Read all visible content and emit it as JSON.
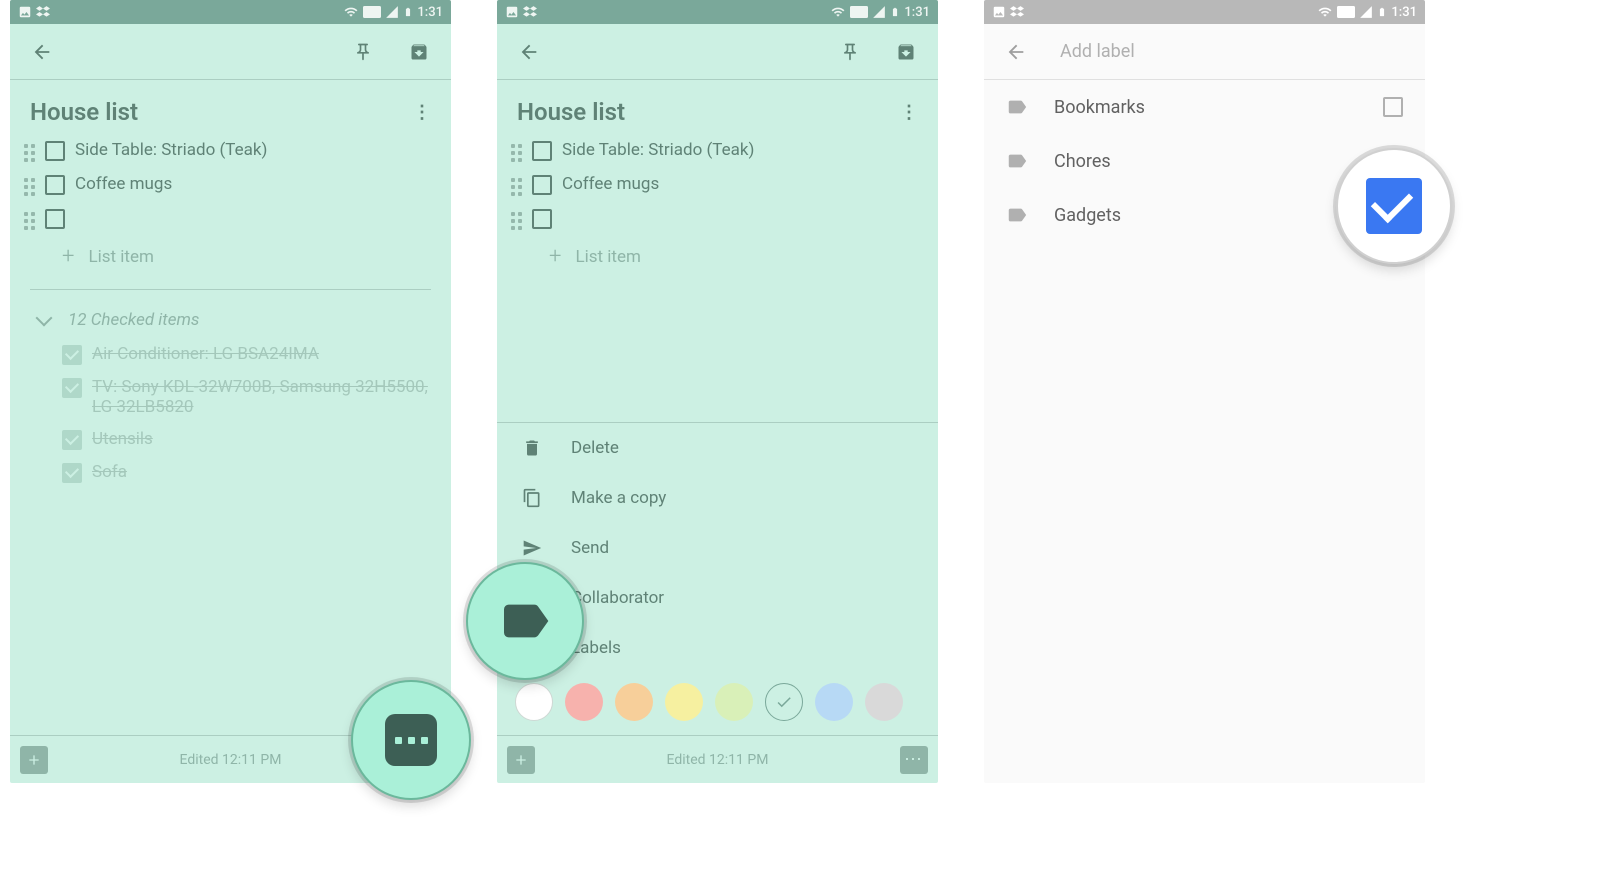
{
  "status": {
    "time": "1:31"
  },
  "screen1": {
    "title": "House list",
    "items": [
      {
        "text": "Side Table: Striado (Teak)"
      },
      {
        "text": "Coffee mugs"
      },
      {
        "text": ""
      }
    ],
    "add_placeholder": "List item",
    "checked_header": "12 Checked items",
    "checked_items": [
      "Air Conditioner: LG BSA24IMA",
      "TV: Sony KDL-32W700B, Samsung 32H5500, LG 32LB5820",
      "Utensils",
      "Sofa"
    ],
    "edited": "Edited 12:11 PM"
  },
  "screen2": {
    "title": "House list",
    "items": [
      {
        "text": "Side Table: Striado (Teak)"
      },
      {
        "text": "Coffee mugs"
      },
      {
        "text": ""
      }
    ],
    "add_placeholder": "List item",
    "sheet": {
      "delete": "Delete",
      "copy": "Make a copy",
      "send": "Send",
      "collab": "Collaborator",
      "labels": "Labels"
    },
    "colors": [
      "#ffffff",
      "#f7b2ad",
      "#f7cf9a",
      "#f6f0a0",
      "#d9f0b8",
      "#ccf0e3",
      "#b7d9f5",
      "#d9d9d9"
    ],
    "edited": "Edited 12:11 PM"
  },
  "screen3": {
    "placeholder": "Add label",
    "labels": [
      "Bookmarks",
      "Chores",
      "Gadgets"
    ]
  }
}
